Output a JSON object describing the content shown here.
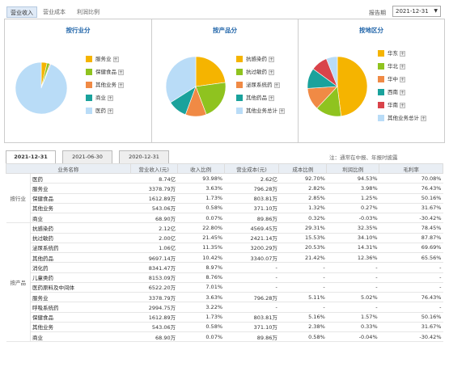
{
  "top_tabs": [
    "营业收入",
    "营业成本",
    "利润比例"
  ],
  "period": {
    "label": "报告期",
    "value": "2021-12-31"
  },
  "panels": [
    {
      "title": "按行业分",
      "legend": [
        {
          "label": "服务业",
          "color": "#f5b400"
        },
        {
          "label": "保健食品",
          "color": "#8fc31f"
        },
        {
          "label": "其他业务",
          "color": "#f08a45"
        },
        {
          "label": "商业",
          "color": "#1aa29c"
        },
        {
          "label": "医药",
          "color": "#b9dcf7"
        }
      ],
      "slices": [
        3.63,
        1.73,
        0.58,
        0.07,
        93.98
      ]
    },
    {
      "title": "按产品分",
      "legend": [
        {
          "label": "抗感染药",
          "color": "#f5b400"
        },
        {
          "label": "抗过敏药",
          "color": "#8fc31f"
        },
        {
          "label": "泌尿系统药",
          "color": "#f08a45"
        },
        {
          "label": "其他药品",
          "color": "#1aa29c"
        },
        {
          "label": "其他业务总计",
          "color": "#b9dcf7"
        }
      ],
      "slices": [
        22.8,
        21.45,
        11.35,
        10.42,
        33.98
      ]
    },
    {
      "title": "按地区分",
      "legend": [
        {
          "label": "华东",
          "color": "#f5b400"
        },
        {
          "label": "华北",
          "color": "#8fc31f"
        },
        {
          "label": "华中",
          "color": "#f08a45"
        },
        {
          "label": "西南",
          "color": "#1aa29c"
        },
        {
          "label": "华南",
          "color": "#d9434a"
        },
        {
          "label": "其他业务总计",
          "color": "#b9dcf7"
        }
      ],
      "slices": [
        48,
        14,
        12,
        11,
        9,
        6
      ]
    }
  ],
  "date_tabs": [
    "2021-12-31",
    "2021-06-30",
    "2020-12-31"
  ],
  "note": "注：通常在中报、年报时披露",
  "columns": [
    "业务名称",
    "营业收入(元)",
    "收入比例",
    "营业成本(元)",
    "成本比例",
    "利润比例",
    "毛利率"
  ],
  "groups": [
    {
      "name": "按行业",
      "rows": [
        [
          "医药",
          "8.74亿",
          "93.98%",
          "2.62亿",
          "92.70%",
          "94.53%",
          "70.08%"
        ],
        [
          "服务业",
          "3378.79万",
          "3.63%",
          "796.28万",
          "2.82%",
          "3.98%",
          "76.43%"
        ],
        [
          "保健食品",
          "1612.89万",
          "1.73%",
          "803.81万",
          "2.85%",
          "1.25%",
          "50.16%"
        ],
        [
          "其他业务",
          "543.06万",
          "0.58%",
          "371.10万",
          "1.32%",
          "0.27%",
          "31.67%"
        ],
        [
          "商业",
          "68.90万",
          "0.07%",
          "89.86万",
          "0.32%",
          "-0.03%",
          "-30.42%"
        ]
      ]
    },
    {
      "name": "按产品",
      "rows": [
        [
          "抗感染药",
          "2.12亿",
          "22.80%",
          "4569.45万",
          "29.31%",
          "32.35%",
          "78.45%"
        ],
        [
          "抗过敏药",
          "2.00亿",
          "21.45%",
          "2421.14万",
          "15.53%",
          "34.10%",
          "87.87%"
        ],
        [
          "泌尿系统药",
          "1.06亿",
          "11.35%",
          "3200.29万",
          "20.53%",
          "14.31%",
          "69.69%"
        ],
        [
          "其他药品",
          "9697.14万",
          "10.42%",
          "3340.07万",
          "21.42%",
          "12.36%",
          "65.56%"
        ],
        [
          "消化药",
          "8341.47万",
          "8.97%",
          "-",
          "-",
          "-",
          "-"
        ],
        [
          "儿童类药",
          "8153.09万",
          "8.76%",
          "-",
          "-",
          "-",
          "-"
        ],
        [
          "医药原料及中间体",
          "6522.20万",
          "7.01%",
          "-",
          "-",
          "-",
          "-"
        ],
        [
          "服务业",
          "3378.79万",
          "3.63%",
          "796.28万",
          "5.11%",
          "5.02%",
          "76.43%"
        ],
        [
          "呼吸系统药",
          "2994.75万",
          "3.22%",
          "-",
          "-",
          "-",
          "-"
        ],
        [
          "保健食品",
          "1612.89万",
          "1.73%",
          "803.81万",
          "5.16%",
          "1.57%",
          "50.16%"
        ],
        [
          "其他业务",
          "543.06万",
          "0.58%",
          "371.10万",
          "2.38%",
          "0.33%",
          "31.67%"
        ],
        [
          "商业",
          "68.90万",
          "0.07%",
          "89.86万",
          "0.58%",
          "-0.04%",
          "-30.42%"
        ]
      ]
    }
  ]
}
